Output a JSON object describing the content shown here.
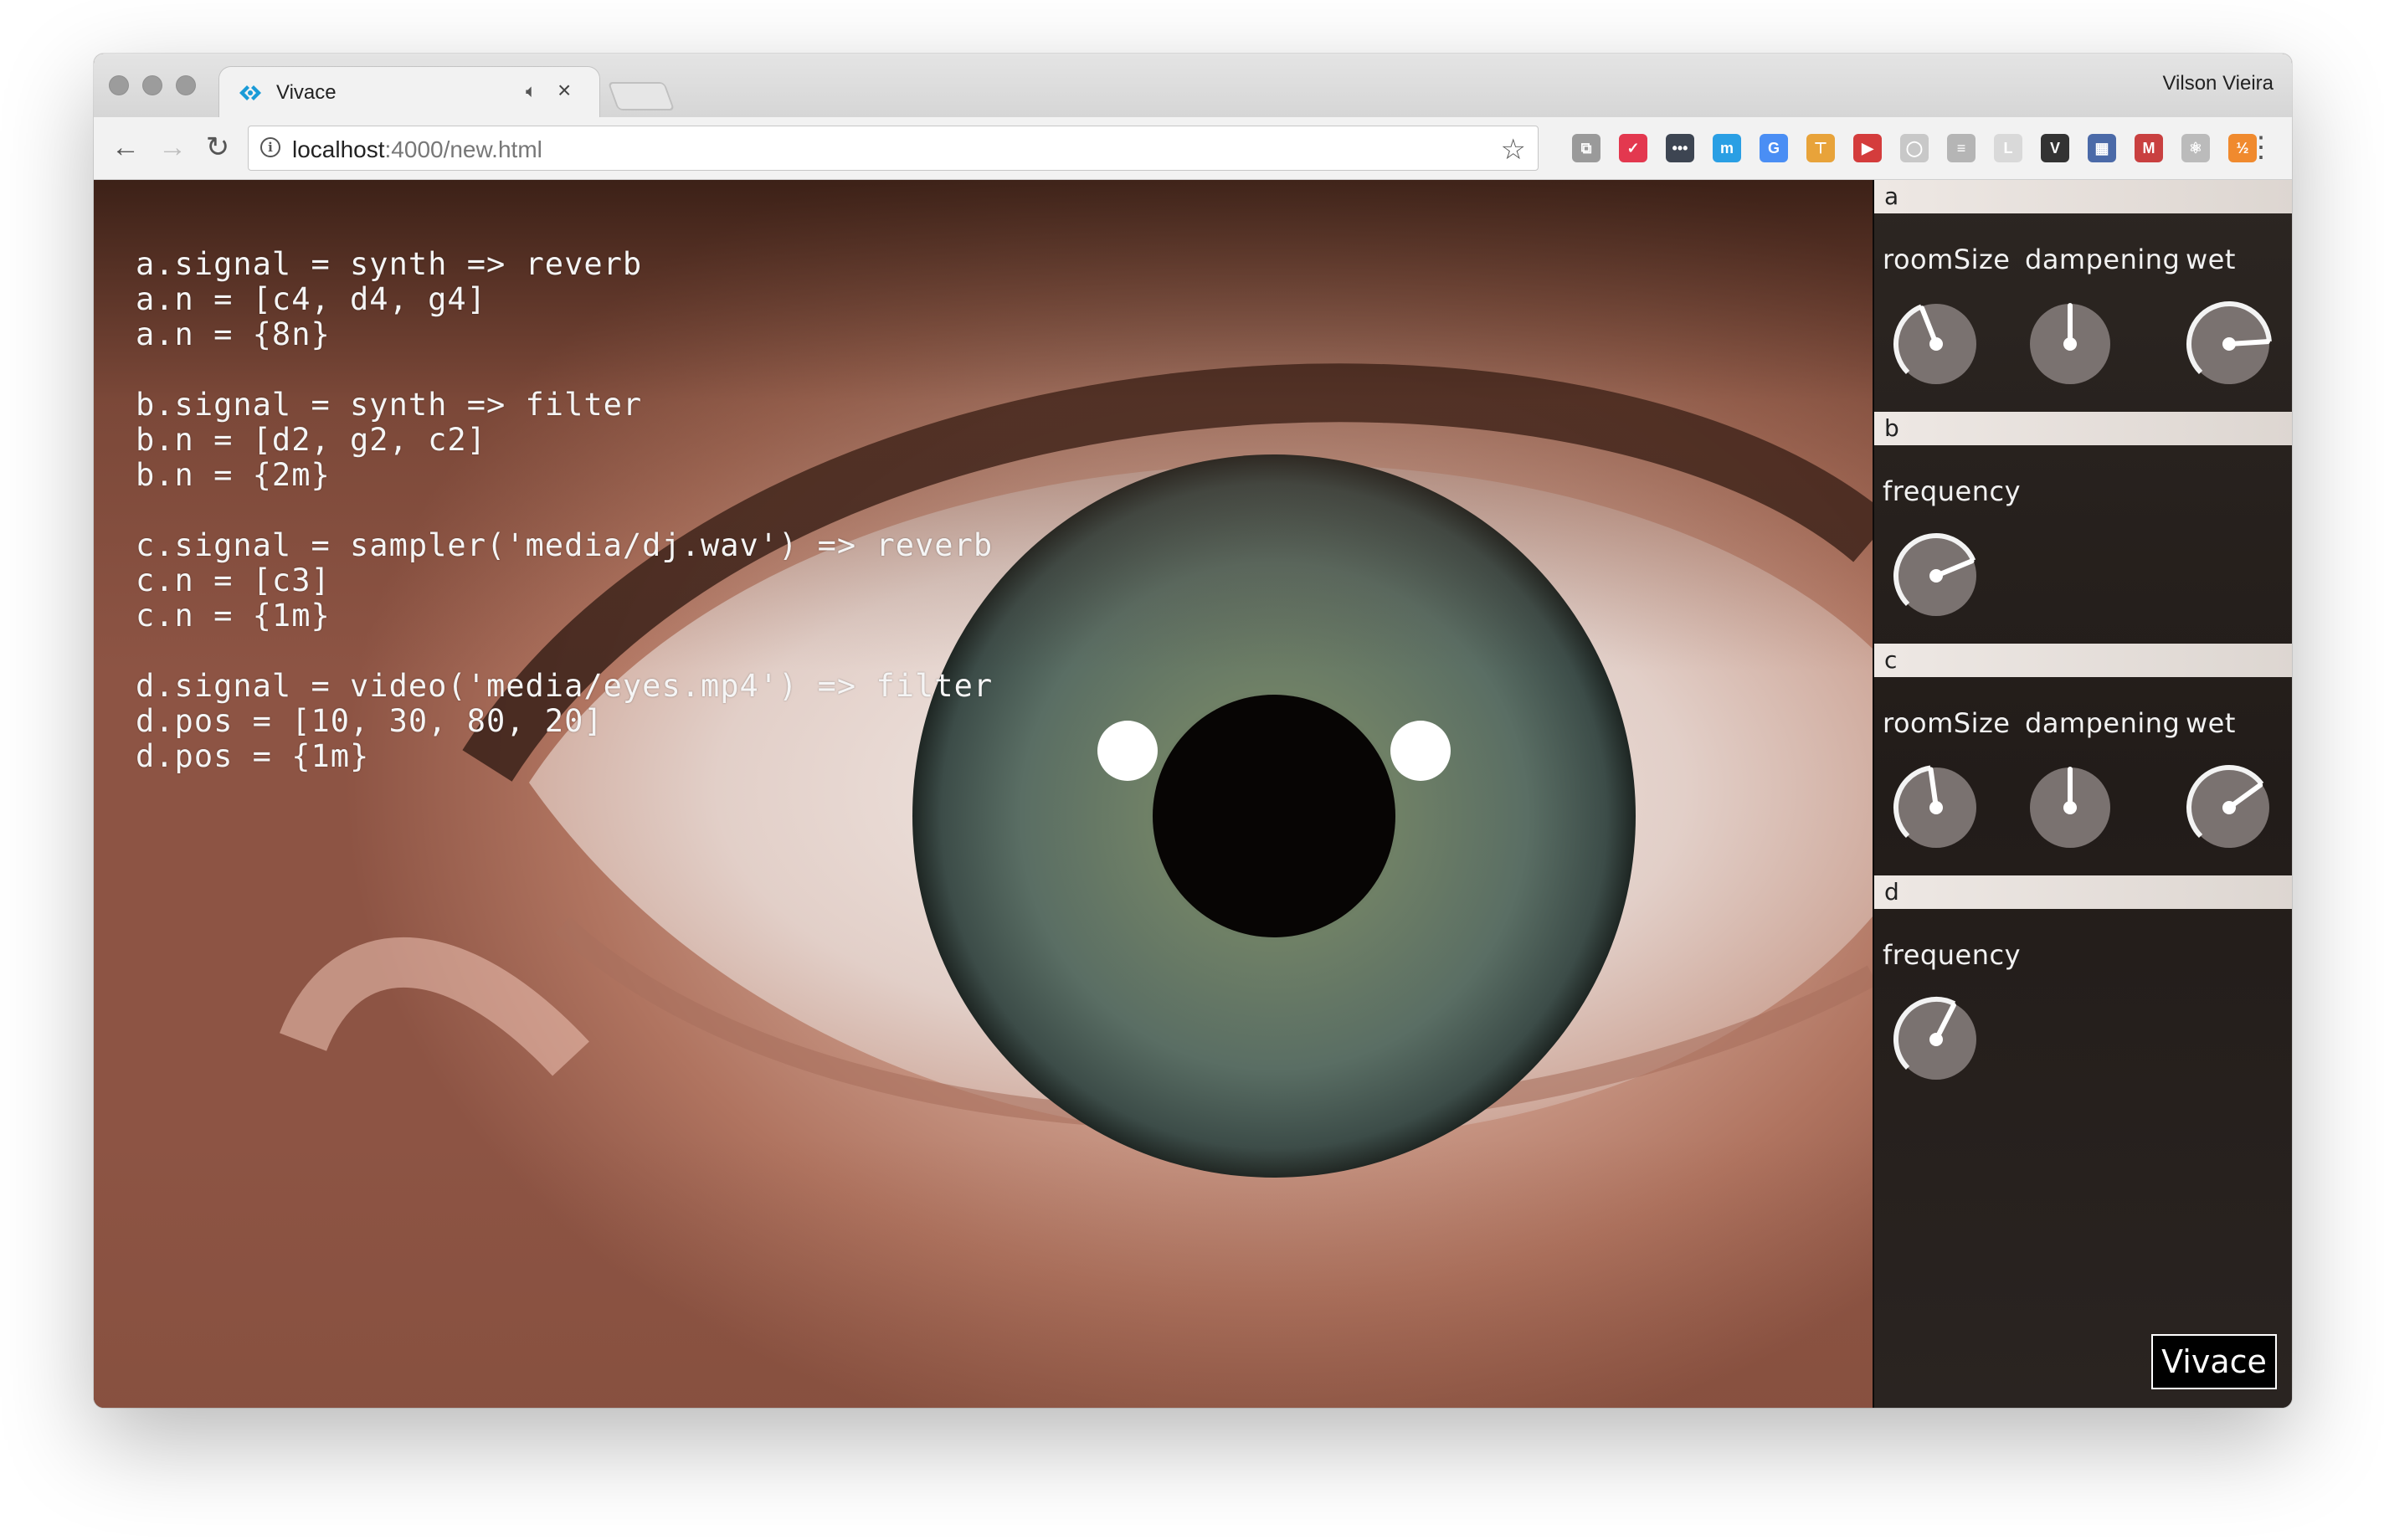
{
  "browser": {
    "tab_title": "Vivace",
    "tab_audio_icon": "speaker-icon",
    "tab_close": "×",
    "profile_name": "Vilson Vieira",
    "url_host": "localhost",
    "url_rest": ":4000/new.html",
    "nav": {
      "back": "←",
      "forward": "→",
      "reload": "↻"
    },
    "bookmark_star": "☆",
    "menu": "⋮"
  },
  "extensions": [
    {
      "name": "ext-1-icon",
      "glyph": "⧉",
      "color": "#9a9a9a"
    },
    {
      "name": "pocket-icon",
      "glyph": "✓",
      "color": "#e3384f"
    },
    {
      "name": "ext-dots-icon",
      "glyph": "•••",
      "color": "#3d4552"
    },
    {
      "name": "ext-circle-icon",
      "glyph": "m",
      "color": "#2a9fe4"
    },
    {
      "name": "google-translate-icon",
      "glyph": "G",
      "color": "#4a8ef4"
    },
    {
      "name": "ext-hammer-icon",
      "glyph": "⊤",
      "color": "#e8a33a"
    },
    {
      "name": "ext-record-icon",
      "glyph": "▶",
      "color": "#d43c3c"
    },
    {
      "name": "ext-ring-icon",
      "glyph": "◯",
      "color": "#c8c8c8"
    },
    {
      "name": "ext-doc-icon",
      "glyph": "≡",
      "color": "#b5b5b5"
    },
    {
      "name": "lyrics-here-icon",
      "glyph": "L",
      "color": "#d9d9d9"
    },
    {
      "name": "ext-v-icon",
      "glyph": "V",
      "color": "#333333"
    },
    {
      "name": "ext-grid-icon",
      "glyph": "▦",
      "color": "#4b6aa8"
    },
    {
      "name": "ext-mask-icon",
      "glyph": "M",
      "color": "#c94040"
    },
    {
      "name": "react-devtools-icon",
      "glyph": "⚛",
      "color": "#bbbbbb"
    },
    {
      "name": "ext-orange-icon",
      "glyph": "½",
      "color": "#f08a2e"
    }
  ],
  "editor": {
    "lines": [
      "a.signal = synth => reverb",
      "a.n = [c4, d4, g4]",
      "a.n = {8n}",
      "",
      "b.signal = synth => filter",
      "b.n = [d2, g2, c2]",
      "b.n = {2m}",
      "",
      "c.signal = sampler('media/dj.wav') => reverb",
      "c.n = [c3]",
      "c.n = {1m}",
      "",
      "d.signal = video('media/eyes.mp4') => filter",
      "d.pos = [10, 30, 80, 20]",
      "d.pos = {1m}"
    ]
  },
  "sidebar": {
    "sections": [
      {
        "name": "a",
        "knobs": [
          {
            "label": "roomSize",
            "value": 0.42,
            "style": "ring"
          },
          {
            "label": "dampening",
            "value": 0.5,
            "style": "plain"
          },
          {
            "label": "wet",
            "value": 0.82,
            "style": "ring"
          }
        ]
      },
      {
        "name": "b",
        "knobs": [
          {
            "label": "frequency",
            "value": 0.75,
            "style": "ring"
          }
        ]
      },
      {
        "name": "c",
        "knobs": [
          {
            "label": "roomSize",
            "value": 0.47,
            "style": "ring"
          },
          {
            "label": "dampening",
            "value": 0.5,
            "style": "plain"
          },
          {
            "label": "wet",
            "value": 0.7,
            "style": "ring"
          }
        ]
      },
      {
        "name": "d",
        "knobs": [
          {
            "label": "frequency",
            "value": 0.6,
            "style": "ring"
          }
        ]
      }
    ],
    "logo": "Vivace"
  },
  "colors": {
    "accent": "#1a9bd7",
    "sidebar_bg": "#241e1b",
    "section_header": "#e8e2de"
  }
}
